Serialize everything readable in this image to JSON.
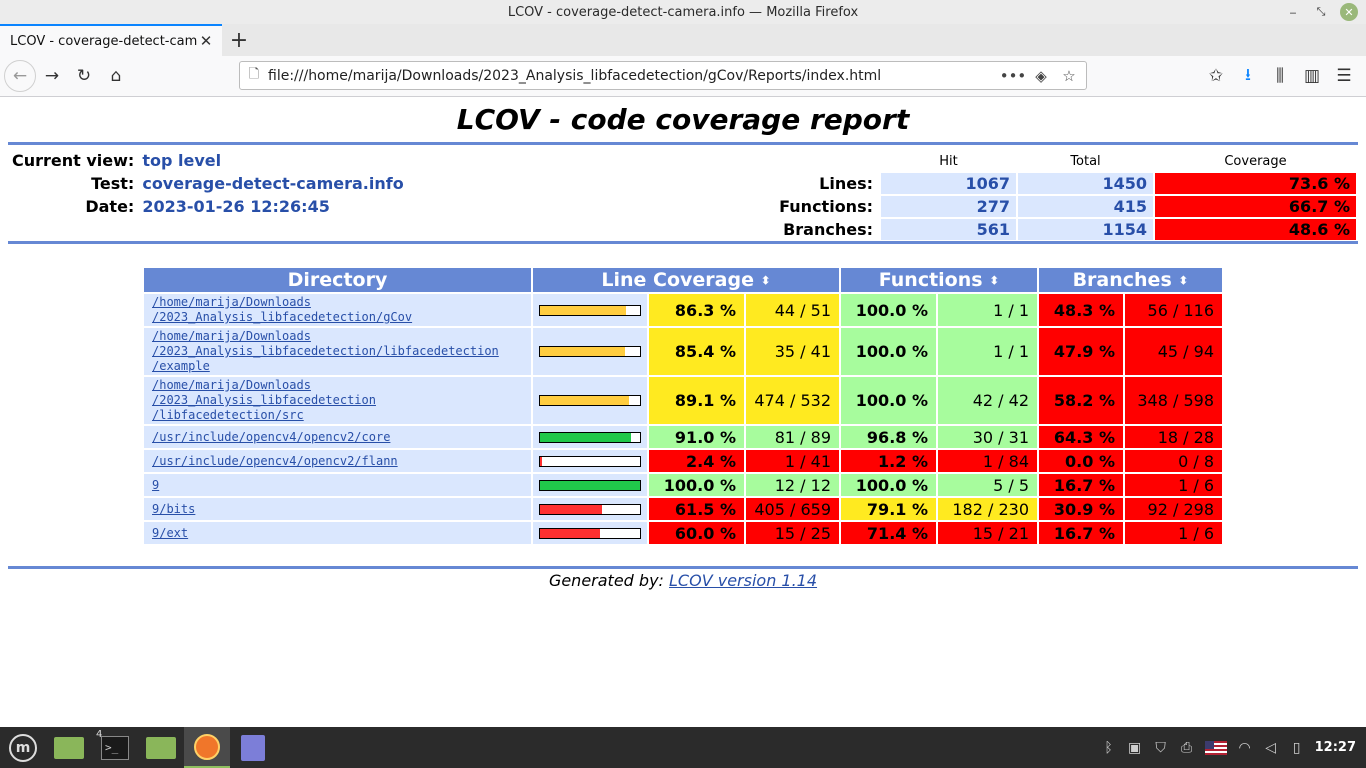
{
  "window": {
    "title": "LCOV - coverage-detect-camera.info — Mozilla Firefox"
  },
  "tab": {
    "title": "LCOV - coverage-detect-camera.info",
    "close": "✕",
    "new_tab": "+"
  },
  "nav": {
    "url": "file:///home/marija/Downloads/2023_Analysis_libfacedetection/gCov/Reports/index.html"
  },
  "report": {
    "title": "LCOV - code coverage report",
    "current_view_label": "Current view:",
    "current_view": "top level",
    "test_label": "Test:",
    "test": "coverage-detect-camera.info",
    "date_label": "Date:",
    "date": "2023-01-26 12:26:45",
    "summary": {
      "col_hit": "Hit",
      "col_total": "Total",
      "col_coverage": "Coverage",
      "rows": [
        {
          "label": "Lines:",
          "hit": "1067",
          "total": "1450",
          "coverage": "73.6 %"
        },
        {
          "label": "Functions:",
          "hit": "277",
          "total": "415",
          "coverage": "66.7 %"
        },
        {
          "label": "Branches:",
          "hit": "561",
          "total": "1154",
          "coverage": "48.6 %"
        }
      ]
    },
    "table": {
      "col_directory": "Directory",
      "col_line": "Line Coverage",
      "col_functions": "Functions",
      "col_branches": "Branches",
      "sort_glyph": "⬍",
      "rows": [
        {
          "path": "/home/marija/Downloads\n/2023_Analysis_libfacedetection/gCov",
          "bar": 0.863,
          "bar_color": "#ffcd40",
          "line_pct": "86.3 %",
          "line_n": "44 / 51",
          "line_bg": "#ffea20",
          "fn_pct": "100.0 %",
          "fn_n": "1 / 1",
          "fn_bg": "#a7fc9d",
          "br_pct": "48.3 %",
          "br_n": "56 / 116",
          "br_bg": "#ff0000"
        },
        {
          "path": "/home/marija/Downloads\n/2023_Analysis_libfacedetection/libfacedetection\n/example",
          "bar": 0.854,
          "bar_color": "#ffcd40",
          "line_pct": "85.4 %",
          "line_n": "35 / 41",
          "line_bg": "#ffea20",
          "fn_pct": "100.0 %",
          "fn_n": "1 / 1",
          "fn_bg": "#a7fc9d",
          "br_pct": "47.9 %",
          "br_n": "45 / 94",
          "br_bg": "#ff0000"
        },
        {
          "path": "/home/marija/Downloads\n/2023_Analysis_libfacedetection\n/libfacedetection/src",
          "bar": 0.891,
          "bar_color": "#ffcd40",
          "line_pct": "89.1 %",
          "line_n": "474 / 532",
          "line_bg": "#ffea20",
          "fn_pct": "100.0 %",
          "fn_n": "42 / 42",
          "fn_bg": "#a7fc9d",
          "br_pct": "58.2 %",
          "br_n": "348 / 598",
          "br_bg": "#ff0000"
        },
        {
          "path": "/usr/include/opencv4/opencv2/core",
          "bar": 0.91,
          "bar_color": "#20c84a",
          "line_pct": "91.0 %",
          "line_n": "81 / 89",
          "line_bg": "#a7fc9d",
          "fn_pct": "96.8 %",
          "fn_n": "30 / 31",
          "fn_bg": "#a7fc9d",
          "br_pct": "64.3 %",
          "br_n": "18 / 28",
          "br_bg": "#ff0000"
        },
        {
          "path": "/usr/include/opencv4/opencv2/flann",
          "bar": 0.024,
          "bar_color": "#ff3030",
          "line_pct": "2.4 %",
          "line_n": "1 / 41",
          "line_bg": "#ff0000",
          "fn_pct": "1.2 %",
          "fn_n": "1 / 84",
          "fn_bg": "#ff0000",
          "br_pct": "0.0 %",
          "br_n": "0 / 8",
          "br_bg": "#ff0000"
        },
        {
          "path": "9",
          "bar": 1.0,
          "bar_color": "#20c84a",
          "line_pct": "100.0 %",
          "line_n": "12 / 12",
          "line_bg": "#a7fc9d",
          "fn_pct": "100.0 %",
          "fn_n": "5 / 5",
          "fn_bg": "#a7fc9d",
          "br_pct": "16.7 %",
          "br_n": "1 / 6",
          "br_bg": "#ff0000"
        },
        {
          "path": "9/bits",
          "bar": 0.615,
          "bar_color": "#ff3030",
          "line_pct": "61.5 %",
          "line_n": "405 / 659",
          "line_bg": "#ff0000",
          "fn_pct": "79.1 %",
          "fn_n": "182 / 230",
          "fn_bg": "#ffea20",
          "br_pct": "30.9 %",
          "br_n": "92 / 298",
          "br_bg": "#ff0000"
        },
        {
          "path": "9/ext",
          "bar": 0.6,
          "bar_color": "#ff3030",
          "line_pct": "60.0 %",
          "line_n": "15 / 25",
          "line_bg": "#ff0000",
          "fn_pct": "71.4 %",
          "fn_n": "15 / 21",
          "fn_bg": "#ff0000",
          "br_pct": "16.7 %",
          "br_n": "1 / 6",
          "br_bg": "#ff0000"
        }
      ]
    },
    "footer_prefix": "Generated by: ",
    "footer_link": "LCOV version 1.14"
  },
  "taskbar": {
    "terminal_badge": "4",
    "clock": "12:27",
    "terminal_prompt": ">_"
  },
  "icons": {
    "back": "←",
    "forward": "→",
    "reload": "↻",
    "home": "⌂",
    "page": "🗋",
    "more": "•••",
    "pocket": "◈",
    "star": "☆",
    "bookmark_star": "✩",
    "download": "⭳",
    "library": "⫼",
    "sidebar": "▥",
    "menu": "☰"
  }
}
